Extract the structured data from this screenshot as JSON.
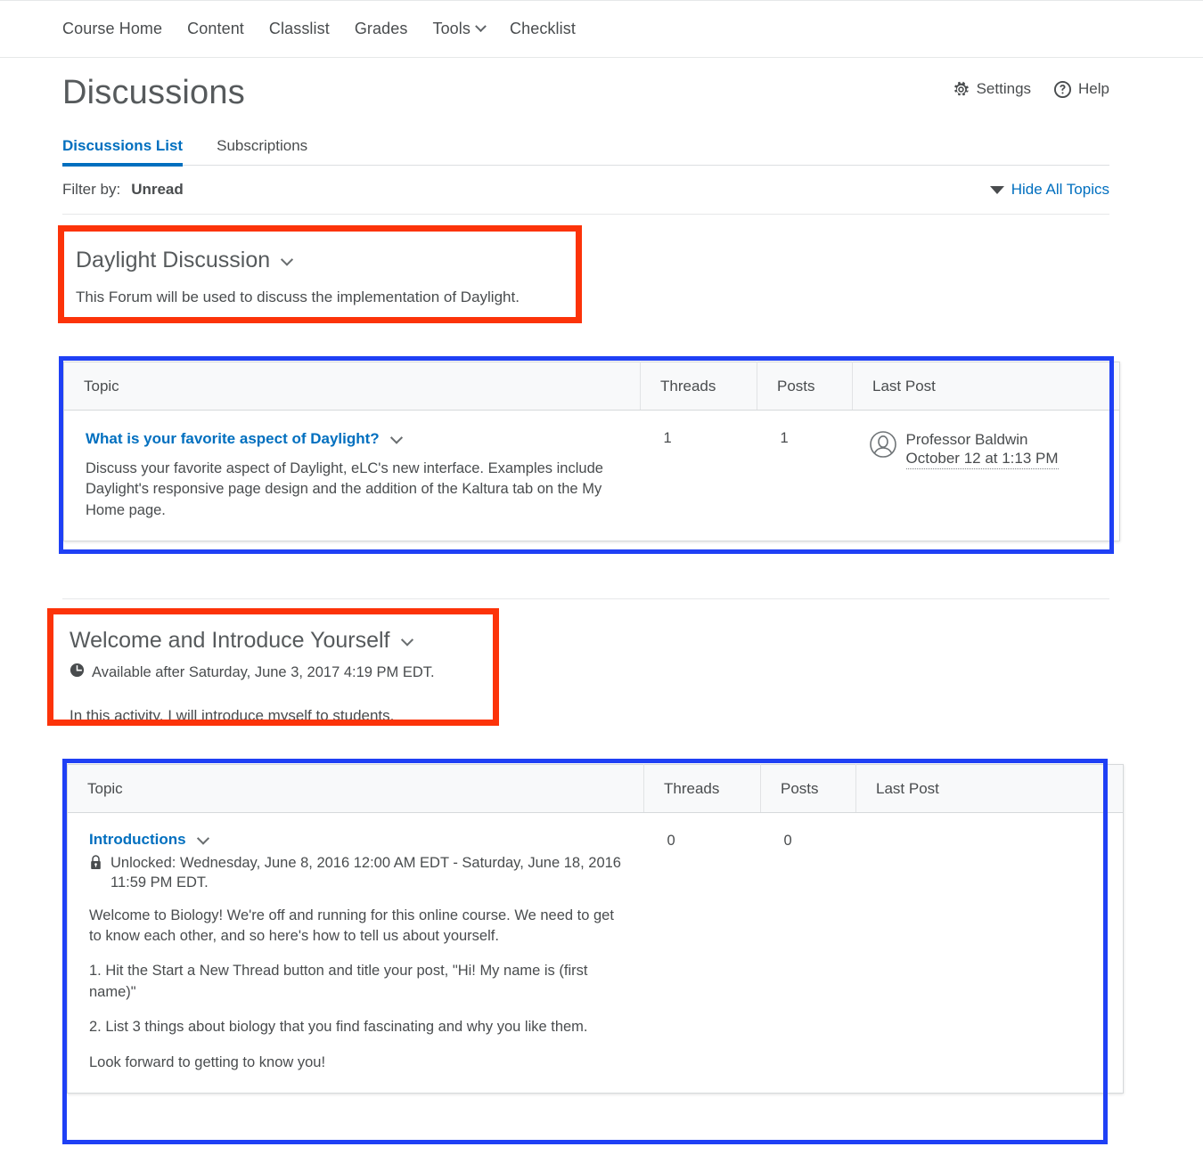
{
  "nav": {
    "items": [
      {
        "label": "Course Home",
        "has_caret": false
      },
      {
        "label": "Content",
        "has_caret": false
      },
      {
        "label": "Classlist",
        "has_caret": false
      },
      {
        "label": "Grades",
        "has_caret": false
      },
      {
        "label": "Tools",
        "has_caret": true
      },
      {
        "label": "Checklist",
        "has_caret": false
      }
    ]
  },
  "header": {
    "title": "Discussions",
    "settings_label": "Settings",
    "help_label": "Help"
  },
  "tabs": [
    {
      "label": "Discussions List",
      "active": true
    },
    {
      "label": "Subscriptions",
      "active": false
    }
  ],
  "filter": {
    "label": "Filter by:",
    "value": "Unread",
    "hide_all_label": "Hide All Topics"
  },
  "columns": {
    "topic": "Topic",
    "threads": "Threads",
    "posts": "Posts",
    "last_post": "Last Post"
  },
  "forums": [
    {
      "title": "Daylight Discussion",
      "description": "This Forum will be used to discuss the implementation of Daylight.",
      "availability": null,
      "topics": [
        {
          "name": "What is your favorite aspect of Daylight?",
          "description": "Discuss your favorite aspect of Daylight, eLC's new interface. Examples include Daylight's responsive page design and the addition of the Kaltura tab on the My Home page.",
          "threads": "1",
          "posts": "1",
          "last_post_author": "Professor Baldwin",
          "last_post_date": "October 12 at 1:13 PM"
        }
      ]
    },
    {
      "title": "Welcome and Introduce Yourself",
      "availability": "Available after Saturday, June 3, 2017 4:19 PM EDT.",
      "description": "In this activity, I will introduce myself to students.",
      "topics": [
        {
          "name": "Introductions",
          "unlocked": "Unlocked: Wednesday, June 8, 2016 12:00 AM EDT - Saturday, June 18, 2016 11:59 PM EDT.",
          "body": [
            "Welcome to Biology! We're off and running for this online course. We need to get to know each other, and so here's how to tell us about yourself.",
            "1. Hit the Start a New Thread button and title your post, \"Hi! My name is (first name)\"",
            "2. List 3 things about biology that you find fascinating and why you like them.",
            "Look forward to getting to know you!"
          ],
          "threads": "0",
          "posts": "0",
          "last_post_author": "",
          "last_post_date": ""
        }
      ]
    }
  ],
  "annotations": {
    "red_color": "#fc3309",
    "blue_color": "#1f40f5"
  }
}
